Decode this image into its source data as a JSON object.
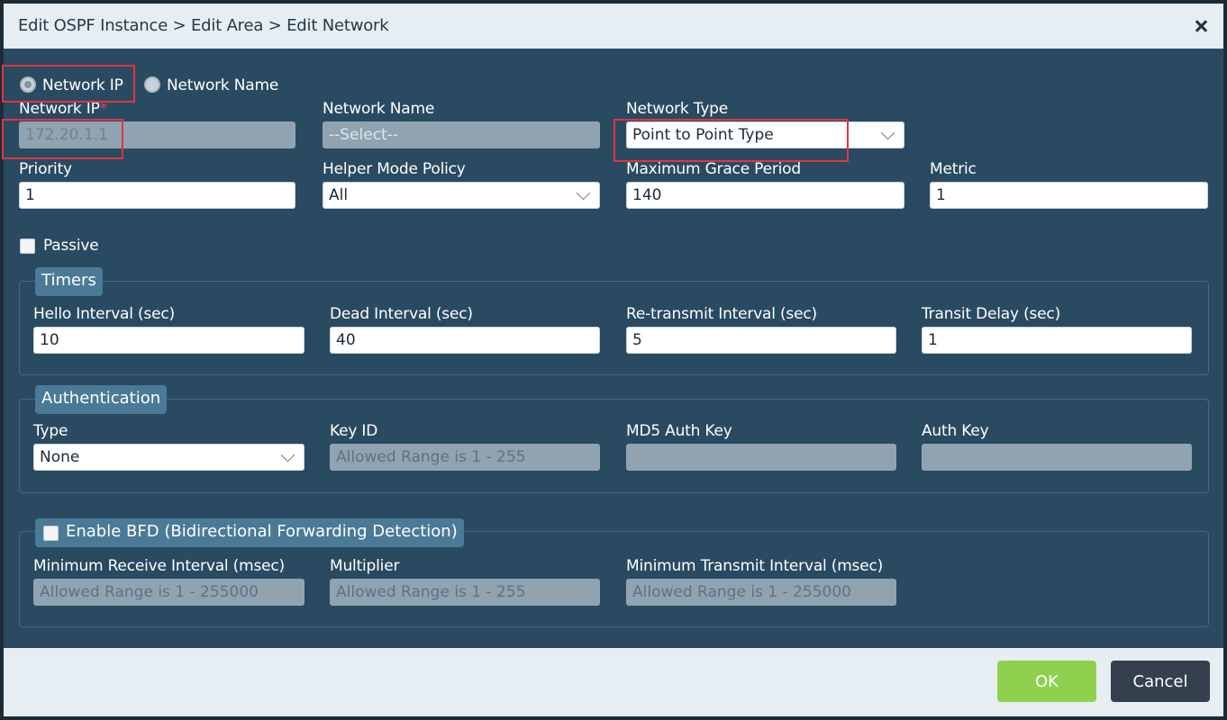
{
  "dialog": {
    "title": "Edit OSPF Instance > Edit Area > Edit Network",
    "close_icon": "close-icon"
  },
  "mode": {
    "network_ip_label": "Network IP",
    "network_name_label": "Network Name"
  },
  "fields": {
    "network_ip": {
      "label": "Network IP",
      "required": "*",
      "value": "172.20.1.1"
    },
    "network_name": {
      "label": "Network Name",
      "value": "--Select--"
    },
    "network_type": {
      "label": "Network Type",
      "value": "Point to Point Type"
    },
    "priority": {
      "label": "Priority",
      "value": "1"
    },
    "helper_mode_policy": {
      "label": "Helper Mode Policy",
      "value": "All"
    },
    "max_grace_period": {
      "label": "Maximum Grace Period",
      "value": "140"
    },
    "metric": {
      "label": "Metric",
      "value": "1"
    },
    "passive": {
      "label": "Passive"
    }
  },
  "timers": {
    "legend": "Timers",
    "hello": {
      "label": "Hello Interval (sec)",
      "value": "10"
    },
    "dead": {
      "label": "Dead Interval (sec)",
      "value": "40"
    },
    "retransmit": {
      "label": "Re-transmit Interval (sec)",
      "value": "5"
    },
    "transit": {
      "label": "Transit Delay (sec)",
      "value": "1"
    }
  },
  "auth": {
    "legend": "Authentication",
    "type": {
      "label": "Type",
      "value": "None"
    },
    "key_id": {
      "label": "Key ID",
      "placeholder": "Allowed Range is 1 - 255"
    },
    "md5": {
      "label": "MD5 Auth Key"
    },
    "auth_key": {
      "label": "Auth Key"
    }
  },
  "bfd": {
    "legend": "Enable BFD (Bidirectional Forwarding Detection)",
    "min_rx": {
      "label": "Minimum Receive Interval (msec)",
      "placeholder": "Allowed Range is 1 - 255000"
    },
    "multiplier": {
      "label": "Multiplier",
      "placeholder": "Allowed Range is 1 - 255"
    },
    "min_tx": {
      "label": "Minimum Transmit Interval (msec)",
      "placeholder": "Allowed Range is 1 - 255000"
    }
  },
  "footer": {
    "ok_label": "OK",
    "cancel_label": "Cancel"
  },
  "colors": {
    "panel_bg": "#2a4a62",
    "header_bg": "#e6eef4",
    "ok_button": "#8fd14f",
    "cancel_button": "#34404d",
    "highlight": "#e0343f"
  }
}
